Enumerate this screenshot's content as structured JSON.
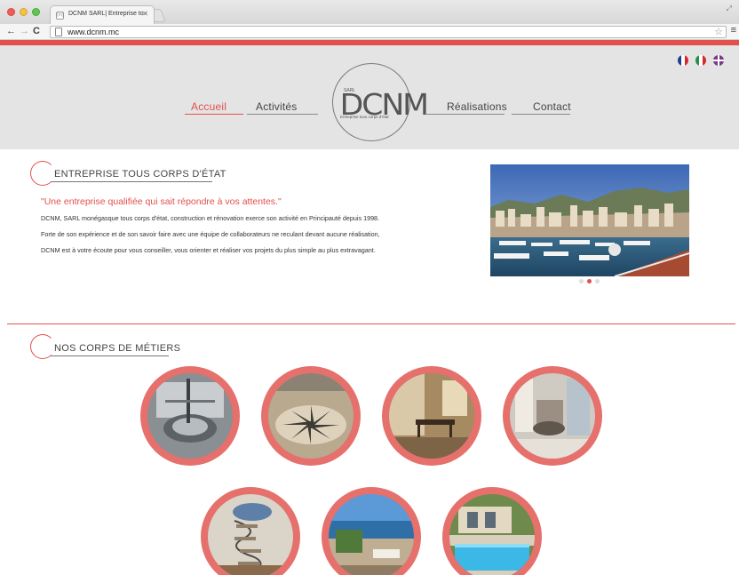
{
  "browser": {
    "tab_title": "DCNM SARL| Entreprise to",
    "tab_favicon": "(m)",
    "url": "www.dcnm.mc"
  },
  "colors": {
    "accent": "#e2504d",
    "header_bg": "#e4e4e4",
    "circle_ring": "#e5706c"
  },
  "flags": [
    "france-flag-icon",
    "italy-flag-icon",
    "uk-flag-icon"
  ],
  "nav": {
    "home": "Accueil",
    "activities": "Activités",
    "projects": "Réalisations",
    "contact": "Contact"
  },
  "logo": {
    "sarl": "SARL",
    "name": "DCNM",
    "tagline": "Entreprise tous corps d'état"
  },
  "intro": {
    "title": "ENTREPRISE TOUS CORPS D'ÉTAT",
    "quote": "\"Une entreprise qualifiée qui sait répondre à vos attentes.\"",
    "p1": "DCNM, SARL monégasque tous corps d'état, construction et rénovation exerce son activité en Principauté depuis 1998.",
    "p2": "Forte de son expérience et de son savoir faire avec une équipe de collaborateurs ne reculant devant aucune réalisation,",
    "p3": "DCNM est à votre écoute pour vous conseiller, vous orienter et réaliser vos projets du plus simple au plus extravagant."
  },
  "slider": {
    "active_index": 1,
    "count": 3
  },
  "trades": {
    "title": "NOS CORPS DE MÉTIERS"
  }
}
